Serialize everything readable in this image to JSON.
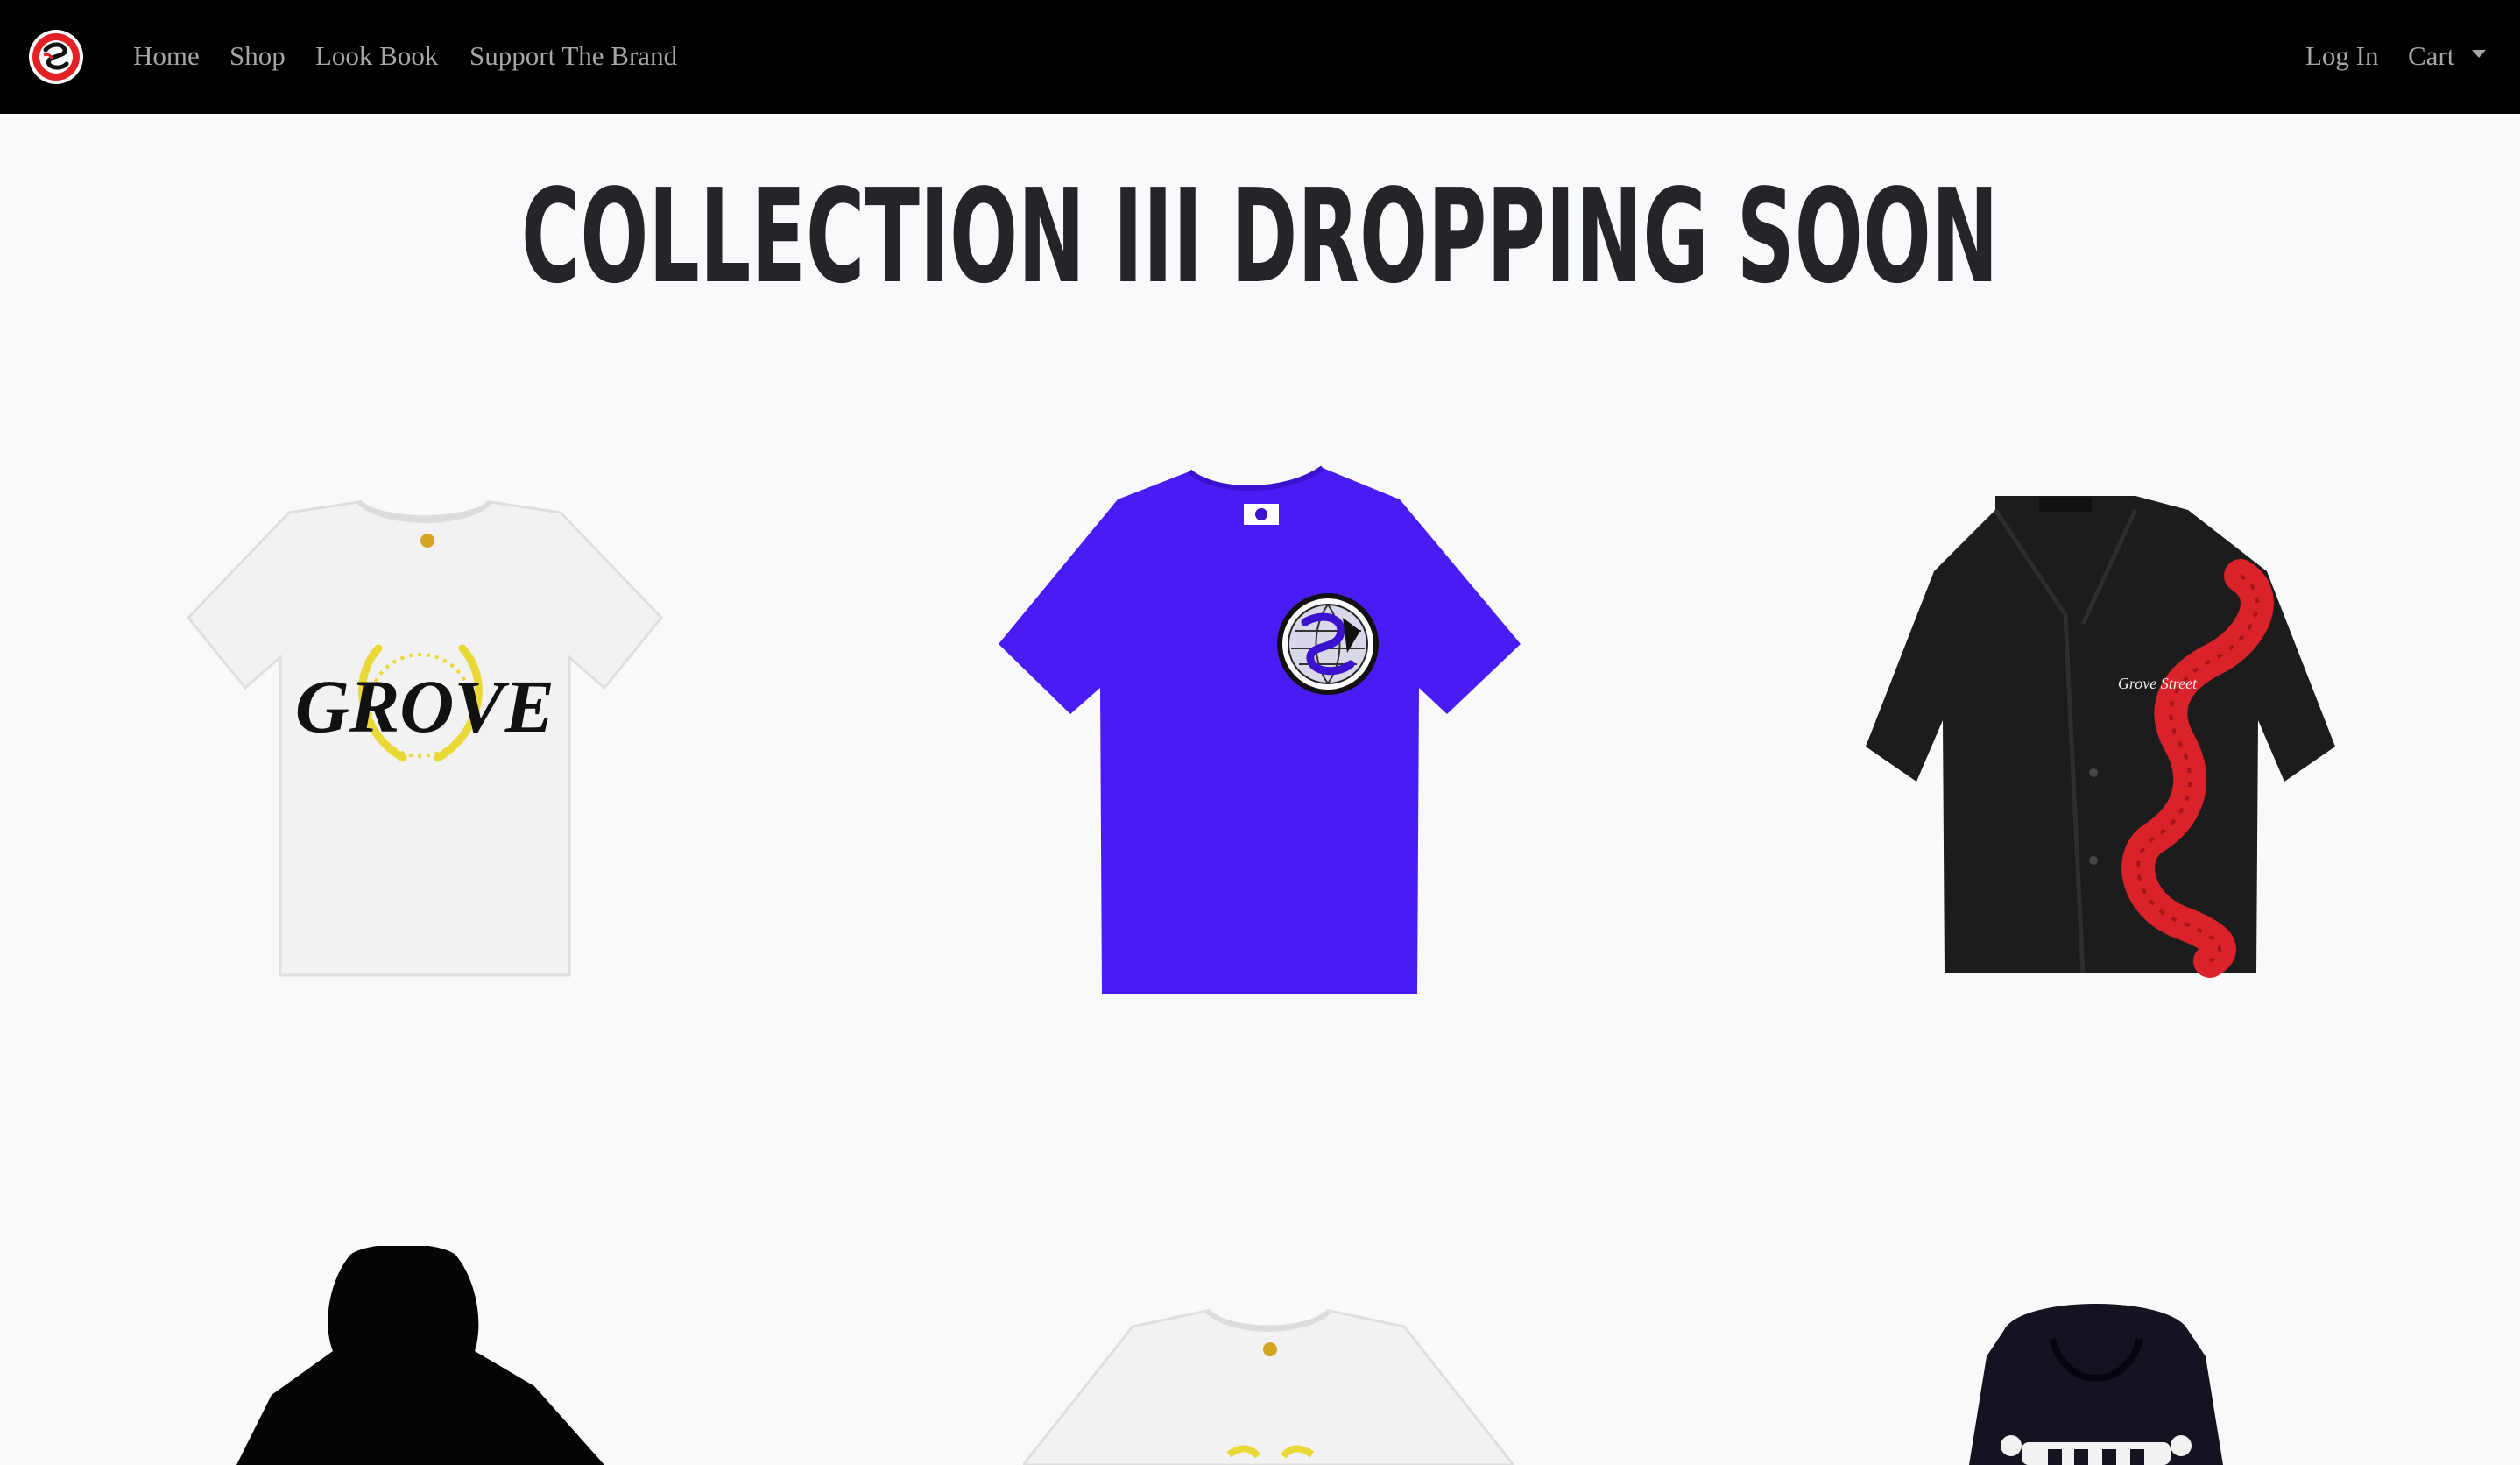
{
  "nav": {
    "logo_name": "brand-snake-logo",
    "links": [
      "Home",
      "Shop",
      "Look Book",
      "Support The Brand"
    ],
    "login": "Log In",
    "cart": "Cart"
  },
  "hero": {
    "headline": "COLLECTION III DROPPING SOON"
  },
  "products": {
    "tee_white_grove": {
      "print_text": "GROVE",
      "colors": {
        "body": "#f2f2f2",
        "wreath": "#e9d835",
        "text": "#111111"
      }
    },
    "tee_blue_globe": {
      "colors": {
        "body": "#4a1cf5",
        "patch": "#111111"
      }
    },
    "shirt_black_snake": {
      "print_text": "Grove Street",
      "colors": {
        "body": "#1c1c1c",
        "snake": "#d9222a"
      }
    },
    "hoodie_black_back": {
      "colors": {
        "body": "#050505"
      }
    },
    "tee_white_partial": {
      "colors": {
        "body": "#f2f2f2",
        "wreath": "#e9d835"
      }
    },
    "hoodie_navy_skeleton": {
      "colors": {
        "body": "#141420",
        "print": "#f2f2f2"
      }
    }
  }
}
